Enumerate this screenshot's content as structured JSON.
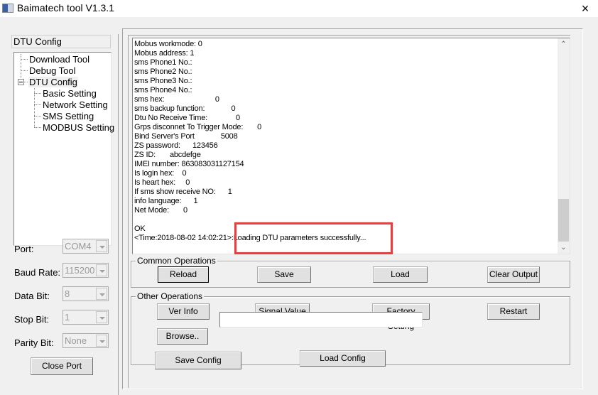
{
  "window": {
    "title": "Baimatech tool V1.3.1",
    "close_label": "×"
  },
  "sidebar": {
    "tab_label": "DTU Config",
    "tree": [
      {
        "label": "Download Tool",
        "level": 0
      },
      {
        "label": "Debug Tool",
        "level": 0
      },
      {
        "label": "DTU Config",
        "level": 0,
        "expanded": true,
        "selected": true
      },
      {
        "label": "Basic Setting",
        "level": 1
      },
      {
        "label": "Network Setting",
        "level": 1
      },
      {
        "label": "SMS Setting",
        "level": 1
      },
      {
        "label": "MODBUS Setting",
        "level": 1
      }
    ],
    "serial": {
      "port": {
        "label": "Port:",
        "value": "COM4"
      },
      "baud_rate": {
        "label": "Baud Rate:",
        "value": "115200"
      },
      "data_bit": {
        "label": "Data Bit:",
        "value": "8"
      },
      "stop_bit": {
        "label": "Stop Bit:",
        "value": "1"
      },
      "parity_bit": {
        "label": "Parity Bit:",
        "value": "None"
      }
    },
    "close_port_label": "Close Port"
  },
  "output": {
    "lines": [
      "Mobus workmode: 0",
      "Mobus address: 1",
      "sms Phone1 No.:",
      "sms Phone2 No.:",
      "sms Phone3 No.:",
      "sms Phone4 No.:",
      "sms hex:                         0",
      "sms backup function:             0",
      "Dtu No Receive Time:              0",
      "Grps disconnet To Trigger Mode:       0",
      "Bind Server's Port             5008",
      "ZS password:      123456",
      "ZS ID:       abcdefge",
      "IMEI number: 863083031127154",
      "Is login hex:    0",
      "Is heart hex:     0",
      "If sms show receive NO:      1",
      "info language:      1",
      "Net Mode:       0",
      "",
      "OK",
      "<Time:2018-08-02 14:02:21>:Loading DTU parameters successfully..."
    ],
    "highlight_color": "#ef3b3b"
  },
  "common_operations": {
    "title": "Common Operations",
    "reload": "Reload",
    "save": "Save",
    "load": "Load",
    "clear_output": "Clear Output"
  },
  "other_operations": {
    "title": "Other Operations",
    "ver_info": "Ver Info",
    "signal_value": "Signal Value",
    "factory_setting": "Factory Setting",
    "restart": "Restart",
    "browse": "Browse..",
    "path_value": "",
    "save_config": "Save Config",
    "load_config": "Load Config"
  }
}
